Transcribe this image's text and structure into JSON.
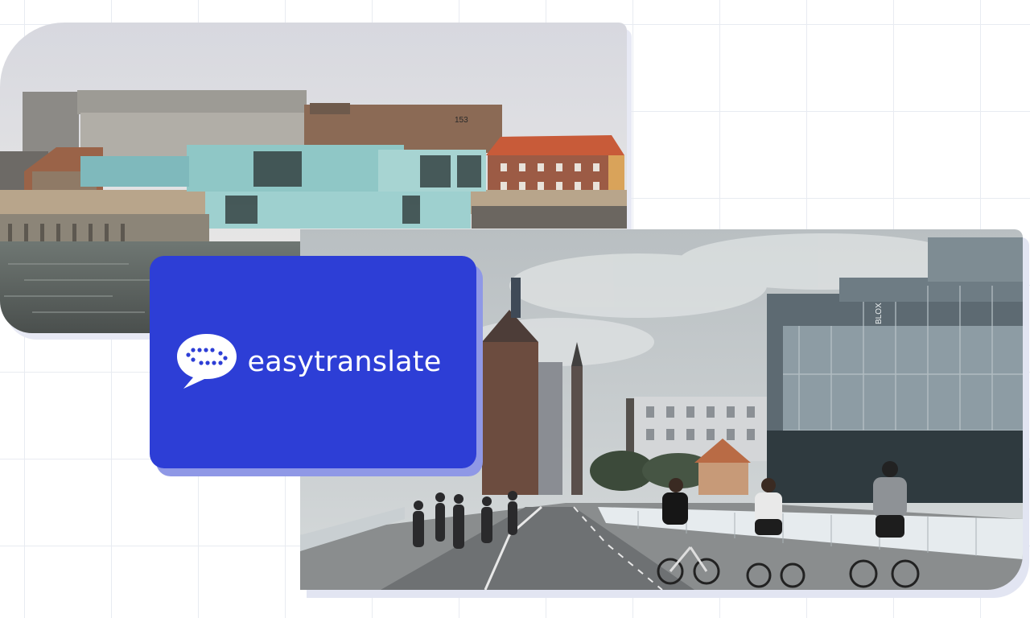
{
  "brand": {
    "name": "easytranslate",
    "logo_icon": "speech-bubble-arrows-icon",
    "card_color": "#2d3ed6",
    "card_shadow_color": "#8f98e6"
  },
  "photos": {
    "harbor": {
      "signage": "153"
    },
    "street": {
      "signage": "BLOX"
    }
  }
}
